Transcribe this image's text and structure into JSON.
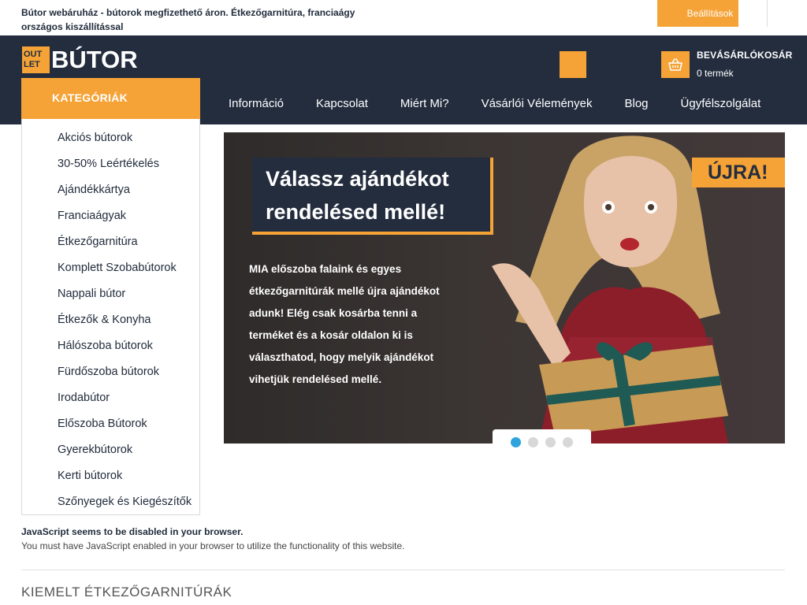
{
  "topbar": {
    "tagline": "Bútor webáruház - bútorok megfizethető áron. Étkezőgarnitúra, franciaágy országos kiszállítással",
    "settings_label": "Beállítások"
  },
  "header": {
    "logo_box_line1": "OUT",
    "logo_box_line2": "LET",
    "logo_text": "BÚTOR",
    "cart_title": "BEVÁSÁRLÓKOSÁR",
    "cart_count": "0 termék",
    "categories_label": "KATEGÓRIÁK"
  },
  "nav": [
    {
      "label": "Információ"
    },
    {
      "label": "Kapcsolat"
    },
    {
      "label": "Miért Mi?"
    },
    {
      "label": "Vásárlói Vélemények"
    },
    {
      "label": "Blog"
    },
    {
      "label": "Ügyfélszolgálat"
    }
  ],
  "categories": [
    {
      "label": "Akciós bútorok"
    },
    {
      "label": "30-50% Leértékelés"
    },
    {
      "label": "Ajándékkártya"
    },
    {
      "label": "Franciaágyak"
    },
    {
      "label": "Étkezőgarnitúra"
    },
    {
      "label": "Komplett Szobabútorok"
    },
    {
      "label": "Nappali bútor"
    },
    {
      "label": "Étkezők & Konyha"
    },
    {
      "label": "Hálószoba bútorok"
    },
    {
      "label": "Fürdőszoba bútorok"
    },
    {
      "label": "Irodabútor"
    },
    {
      "label": "Előszoba Bútorok"
    },
    {
      "label": "Gyerekbútorok"
    },
    {
      "label": "Kerti bútorok"
    },
    {
      "label": "Szőnyegek és Kiegészítők"
    }
  ],
  "banner": {
    "headline_line1": "Válassz ajándékot",
    "headline_line2": "rendelésed mellé!",
    "tag": "ÚJRA!",
    "text": "MIA előszoba falaink és egyes étkezőgarnitúrák mellé újra ajándékot adunk! Elég csak kosárba tenni a terméket és a kosár oldalon ki is választhatod, hogy melyik ajándékot vihetjük rendelésed mellé.",
    "slides_total": 4,
    "active_slide": 1
  },
  "notice": {
    "title": "JavaScript seems to be disabled in your browser.",
    "message": "You must have JavaScript enabled in your browser to utilize the functionality of this website."
  },
  "section": {
    "title": "KIEMELT ÉTKEZŐGARNITÚRÁK"
  },
  "colors": {
    "accent": "#f5a337",
    "header_bg": "#232d3e",
    "active_dot": "#2fa4dc"
  }
}
